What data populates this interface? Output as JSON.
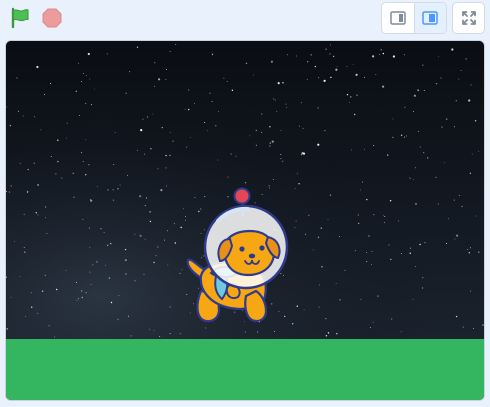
{
  "toolbar": {
    "green_flag_icon": "green-flag-icon",
    "stop_icon": "stop-icon",
    "small_stage_icon": "small-stage-icon",
    "normal_stage_icon": "normal-stage-icon",
    "fullscreen_icon": "fullscreen-icon",
    "active_mode": "normal"
  },
  "stage": {
    "backdrop": "space",
    "ground_color": "#33b65f",
    "sprite": "space-dog-astronaut"
  },
  "colors": {
    "flag_green": "#4cbf56",
    "stop_red": "#ec9c9c",
    "accent_blue": "#4c97ff",
    "header_bg": "#e9f1fc"
  }
}
